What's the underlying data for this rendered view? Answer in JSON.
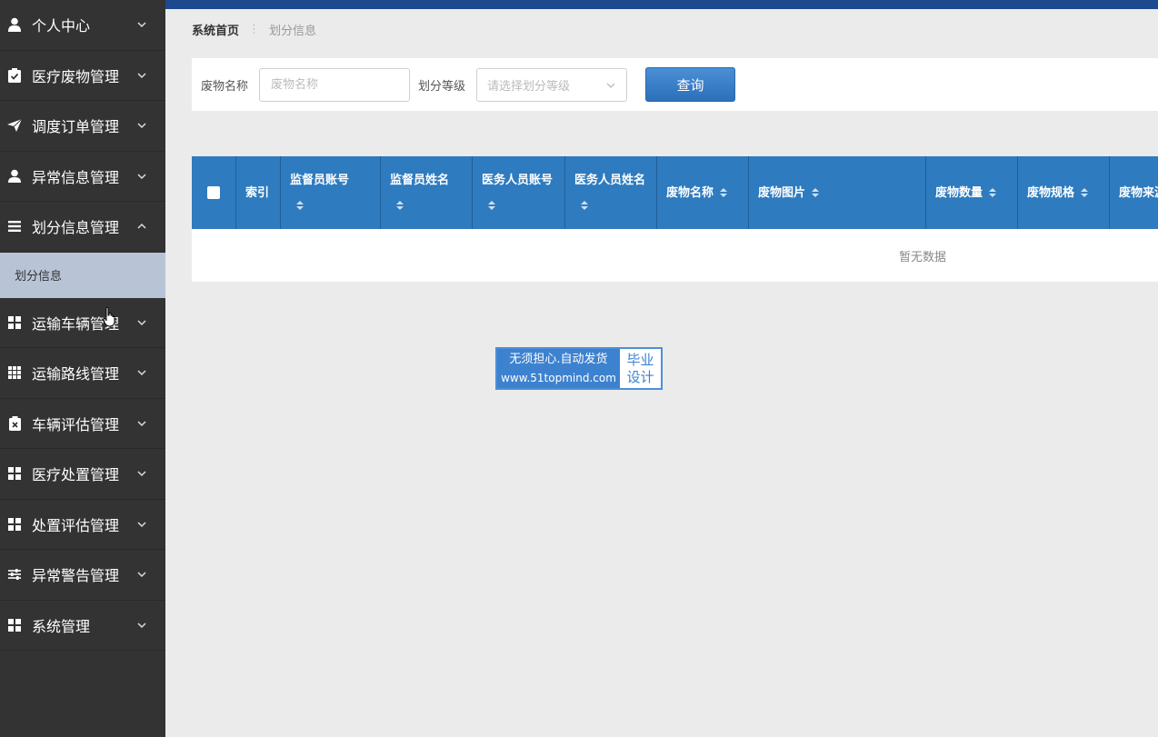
{
  "sidebar": {
    "items": [
      {
        "label": "个人中心",
        "icon": "user-icon"
      },
      {
        "label": "医疗废物管理",
        "icon": "clipboard-icon"
      },
      {
        "label": "调度订单管理",
        "icon": "send-icon"
      },
      {
        "label": "异常信息管理",
        "icon": "user-icon"
      },
      {
        "label": "划分信息管理",
        "icon": "list-icon",
        "expanded": true
      },
      {
        "label": "运输车辆管理",
        "icon": "grid-icon"
      },
      {
        "label": "运输路线管理",
        "icon": "grid9-icon"
      },
      {
        "label": "车辆评估管理",
        "icon": "clipboard-x-icon"
      },
      {
        "label": "医疗处置管理",
        "icon": "grid-icon"
      },
      {
        "label": "处置评估管理",
        "icon": "grid-icon"
      },
      {
        "label": "异常警告管理",
        "icon": "sliders-icon"
      },
      {
        "label": "系统管理",
        "icon": "grid-icon"
      }
    ],
    "active_sub_item": "划分信息"
  },
  "breadcrumb": {
    "home": "系统首页",
    "separator": "⋮",
    "current": "划分信息"
  },
  "search": {
    "waste_name_label": "废物名称",
    "waste_name_placeholder": "废物名称",
    "level_label": "划分等级",
    "level_placeholder": "请选择划分等级",
    "query_button": "查询"
  },
  "table": {
    "columns": [
      {
        "label": "索引",
        "sortable": false
      },
      {
        "label": "监督员账号",
        "sortable": true
      },
      {
        "label": "监督员姓名",
        "sortable": true
      },
      {
        "label": "医务人员账号",
        "sortable": true
      },
      {
        "label": "医务人员姓名",
        "sortable": true
      },
      {
        "label": "废物名称",
        "sortable": true
      },
      {
        "label": "废物图片",
        "sortable": true
      },
      {
        "label": "废物数量",
        "sortable": true
      },
      {
        "label": "废物规格",
        "sortable": true
      },
      {
        "label": "废物来源",
        "sortable": true
      }
    ],
    "empty_text": "暂无数据"
  },
  "watermark": {
    "line1": "无须担心.自动发货",
    "line2": "www.51topmind.com",
    "right1": "毕业",
    "right2": "设计"
  },
  "colors": {
    "sidebar_bg": "#333333",
    "topbar": "#1d4a8f",
    "table_header": "#2e7bbf",
    "button": "#3a7fc9",
    "active_sub": "#b8c4d6"
  }
}
